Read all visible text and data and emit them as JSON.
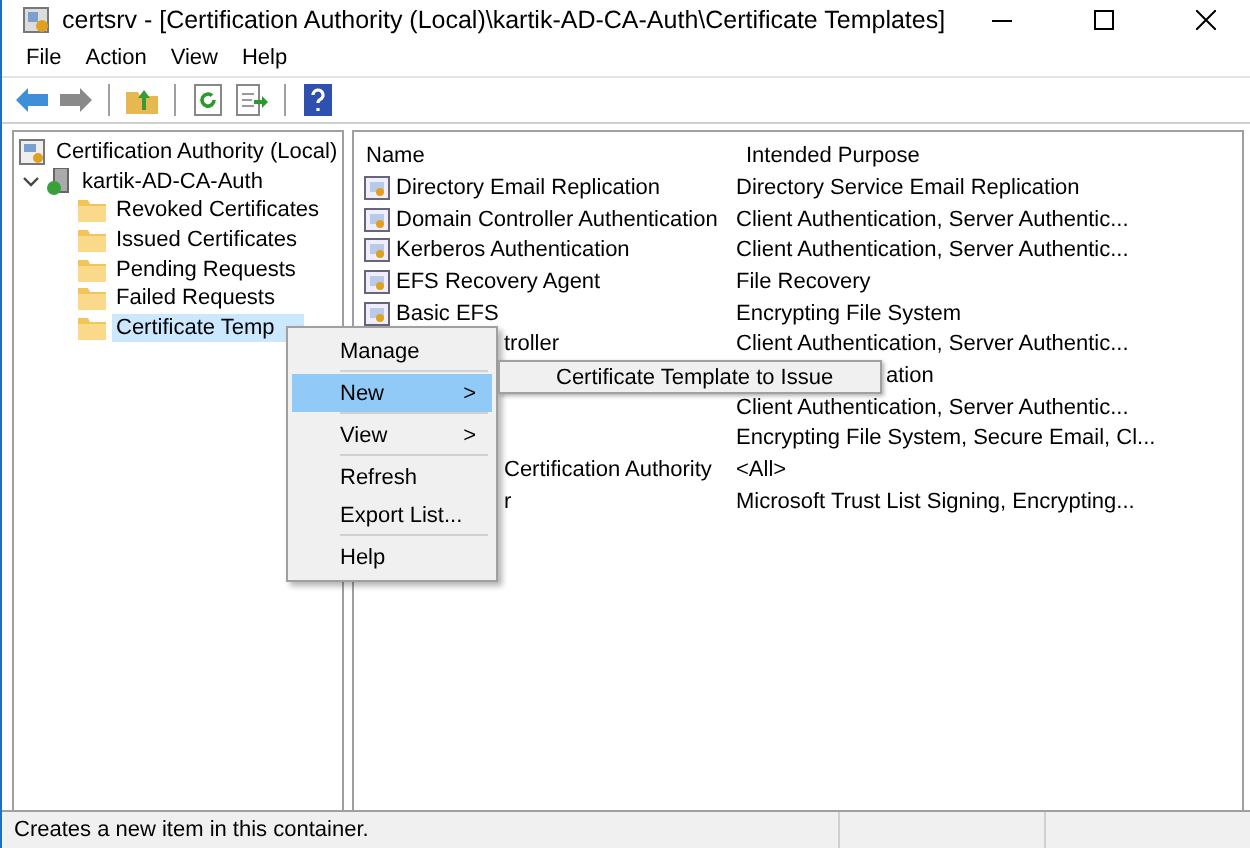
{
  "window": {
    "title": "certsrv - [Certification Authority (Local)\\kartik-AD-CA-Auth\\Certificate Templates]"
  },
  "menu_bar": [
    "File",
    "Action",
    "View",
    "Help"
  ],
  "tree": {
    "label": "Certification Authority (Local)",
    "children": [
      {
        "label": "kartik-AD-CA-Auth",
        "expanded": true,
        "children": [
          {
            "label": "Revoked Certificates",
            "selected": false
          },
          {
            "label": "Issued Certificates",
            "selected": false
          },
          {
            "label": "Pending Requests",
            "selected": false
          },
          {
            "label": "Failed Requests",
            "selected": false
          },
          {
            "label": "Certificate Temp",
            "selected": true
          }
        ]
      }
    ]
  },
  "table": {
    "columns": [
      "Name",
      "Intended Purpose"
    ],
    "rows": [
      {
        "kind": "full",
        "name": "Directory Email Replication",
        "purpose": "Directory Service Email Replication"
      },
      {
        "kind": "full",
        "name": "Domain Controller Authentication",
        "purpose": "Client Authentication, Server Authentic..."
      },
      {
        "kind": "full",
        "name": "Kerberos Authentication",
        "purpose": "Client Authentication, Server Authentic..."
      },
      {
        "kind": "full",
        "name": "EFS Recovery Agent",
        "purpose": "File Recovery"
      },
      {
        "kind": "full",
        "name": "Basic EFS",
        "purpose": "Encrypting File System"
      },
      {
        "kind": "under_menu",
        "name": "troller",
        "purpose": "Client Authentication, Server Authentic..."
      },
      {
        "kind": "under_submenu",
        "purpose": "ation"
      },
      {
        "kind": "under_menu",
        "purpose": "Client Authentication, Server Authentic..."
      },
      {
        "kind": "under_menu",
        "purpose": "Encrypting File System, Secure Email, Cl..."
      },
      {
        "kind": "under_menu",
        "name": "Certification Authority",
        "purpose": "<All>"
      },
      {
        "kind": "under_menu",
        "name": "r",
        "purpose": "Microsoft Trust List Signing, Encrypting..."
      }
    ]
  },
  "context_menu": [
    {
      "kind": "item",
      "label": "Manage",
      "selected": false
    },
    {
      "kind": "separator"
    },
    {
      "kind": "submenu",
      "label": "New",
      "arrow": ">",
      "selected": true
    },
    {
      "kind": "separator"
    },
    {
      "kind": "submenu",
      "label": "View",
      "arrow": ">",
      "selected": false
    },
    {
      "kind": "separator"
    },
    {
      "kind": "item",
      "label": "Refresh",
      "selected": false
    },
    {
      "kind": "item",
      "label": "Export List...",
      "selected": false
    },
    {
      "kind": "separator"
    },
    {
      "kind": "item",
      "label": "Help",
      "selected": false
    }
  ],
  "submenu": [
    {
      "label": "Certificate Template to Issue",
      "selected": false
    }
  ],
  "status_bar": {
    "text": "Creates a new item in this container."
  }
}
